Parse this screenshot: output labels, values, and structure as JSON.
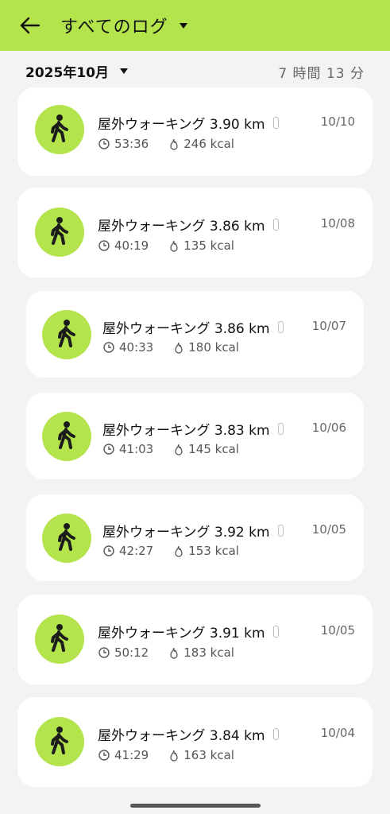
{
  "header": {
    "title": "すべてのログ"
  },
  "summary": {
    "month": "2025年10月",
    "total_time": "7 時間 13 分"
  },
  "logs": [
    {
      "title": "屋外ウォーキング 3.90 km",
      "date": "10/10",
      "duration": "53:36",
      "calories": "246 kcal"
    },
    {
      "title": "屋外ウォーキング 3.86 km",
      "date": "10/08",
      "duration": "40:19",
      "calories": "135 kcal"
    },
    {
      "title": "屋外ウォーキング 3.86 km",
      "date": "10/07",
      "duration": "40:33",
      "calories": "180 kcal"
    },
    {
      "title": "屋外ウォーキング 3.83 km",
      "date": "10/06",
      "duration": "41:03",
      "calories": "145 kcal"
    },
    {
      "title": "屋外ウォーキング 3.92 km",
      "date": "10/05",
      "duration": "42:27",
      "calories": "153 kcal"
    },
    {
      "title": "屋外ウォーキング 3.91 km",
      "date": "10/05",
      "duration": "50:12",
      "calories": "183 kcal"
    },
    {
      "title": "屋外ウォーキング 3.84 km",
      "date": "10/04",
      "duration": "41:29",
      "calories": "163 kcal"
    }
  ],
  "colors": {
    "accent": "#b3e44c",
    "background": "#f2f3f5",
    "card": "#ffffff"
  },
  "icons": {
    "back": "arrow-left-icon",
    "activity": "walking-person-icon",
    "duration": "clock-icon",
    "calories": "flame-icon",
    "device": "watch-icon"
  }
}
